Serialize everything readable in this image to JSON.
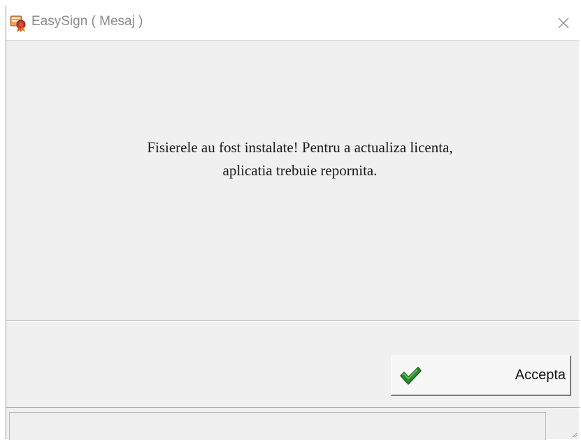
{
  "window": {
    "title": "EasySign ( Mesaj )",
    "icon": "certificate-ribbon-icon",
    "close_icon": "close-icon"
  },
  "message": {
    "line1": "Fisierele au fost instalate! Pentru a actualiza licenta,",
    "line2": "aplicatia trebuie repornita."
  },
  "buttons": {
    "accept_label": "Accepta",
    "accept_icon": "green-check-icon"
  },
  "status_bar": {
    "text": ""
  },
  "colors": {
    "dialog_bg": "#f0f0f0",
    "title_text": "#8a8a8a",
    "check_green": "#2e8b2e",
    "icon_red": "#c0392b",
    "icon_orange": "#e67e22"
  }
}
